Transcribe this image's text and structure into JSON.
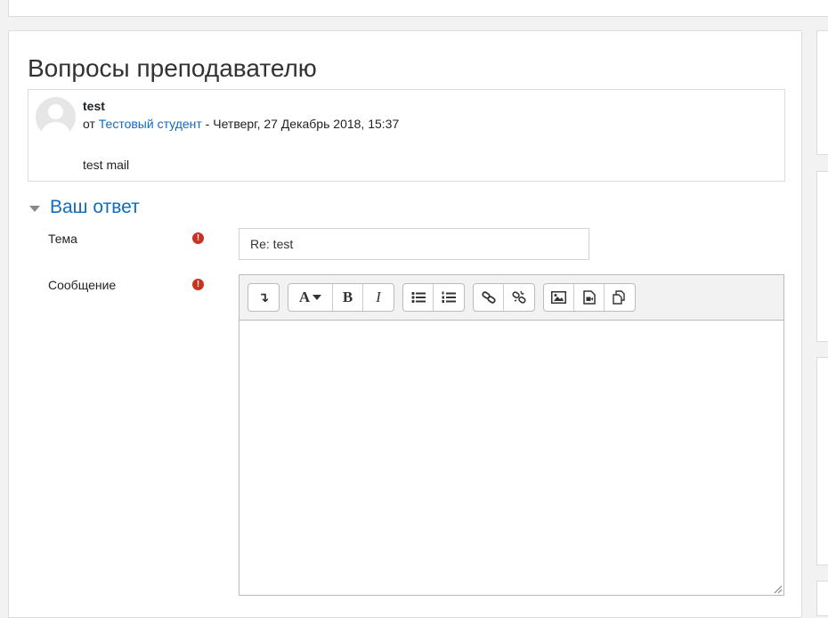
{
  "page_title": "Вопросы преподавателю",
  "post": {
    "subject": "test",
    "by_prefix": "от",
    "author": "Тестовый студент",
    "date_separator": " - ",
    "date": "Четверг, 27 Декабрь 2018, 15:37",
    "body": "test mail"
  },
  "reply_section": {
    "title": "Ваш ответ",
    "subject_label": "Тема",
    "subject_value": "Re: test",
    "message_label": "Сообщение",
    "required_icon": "exclamation-circle-icon"
  },
  "toolbar": {
    "groups": [
      [
        "collapse-icon"
      ],
      [
        "font-style-icon",
        "bold-icon",
        "italic-icon"
      ],
      [
        "unordered-list-icon",
        "ordered-list-icon"
      ],
      [
        "link-icon",
        "unlink-icon"
      ],
      [
        "image-icon",
        "media-icon",
        "manage-files-icon"
      ]
    ],
    "bold_glyph": "B",
    "italic_glyph": "I",
    "font_glyph": "A",
    "collapse_glyph": "↴"
  },
  "colors": {
    "accent": "#0f6cbf",
    "required": "#ca3120"
  }
}
